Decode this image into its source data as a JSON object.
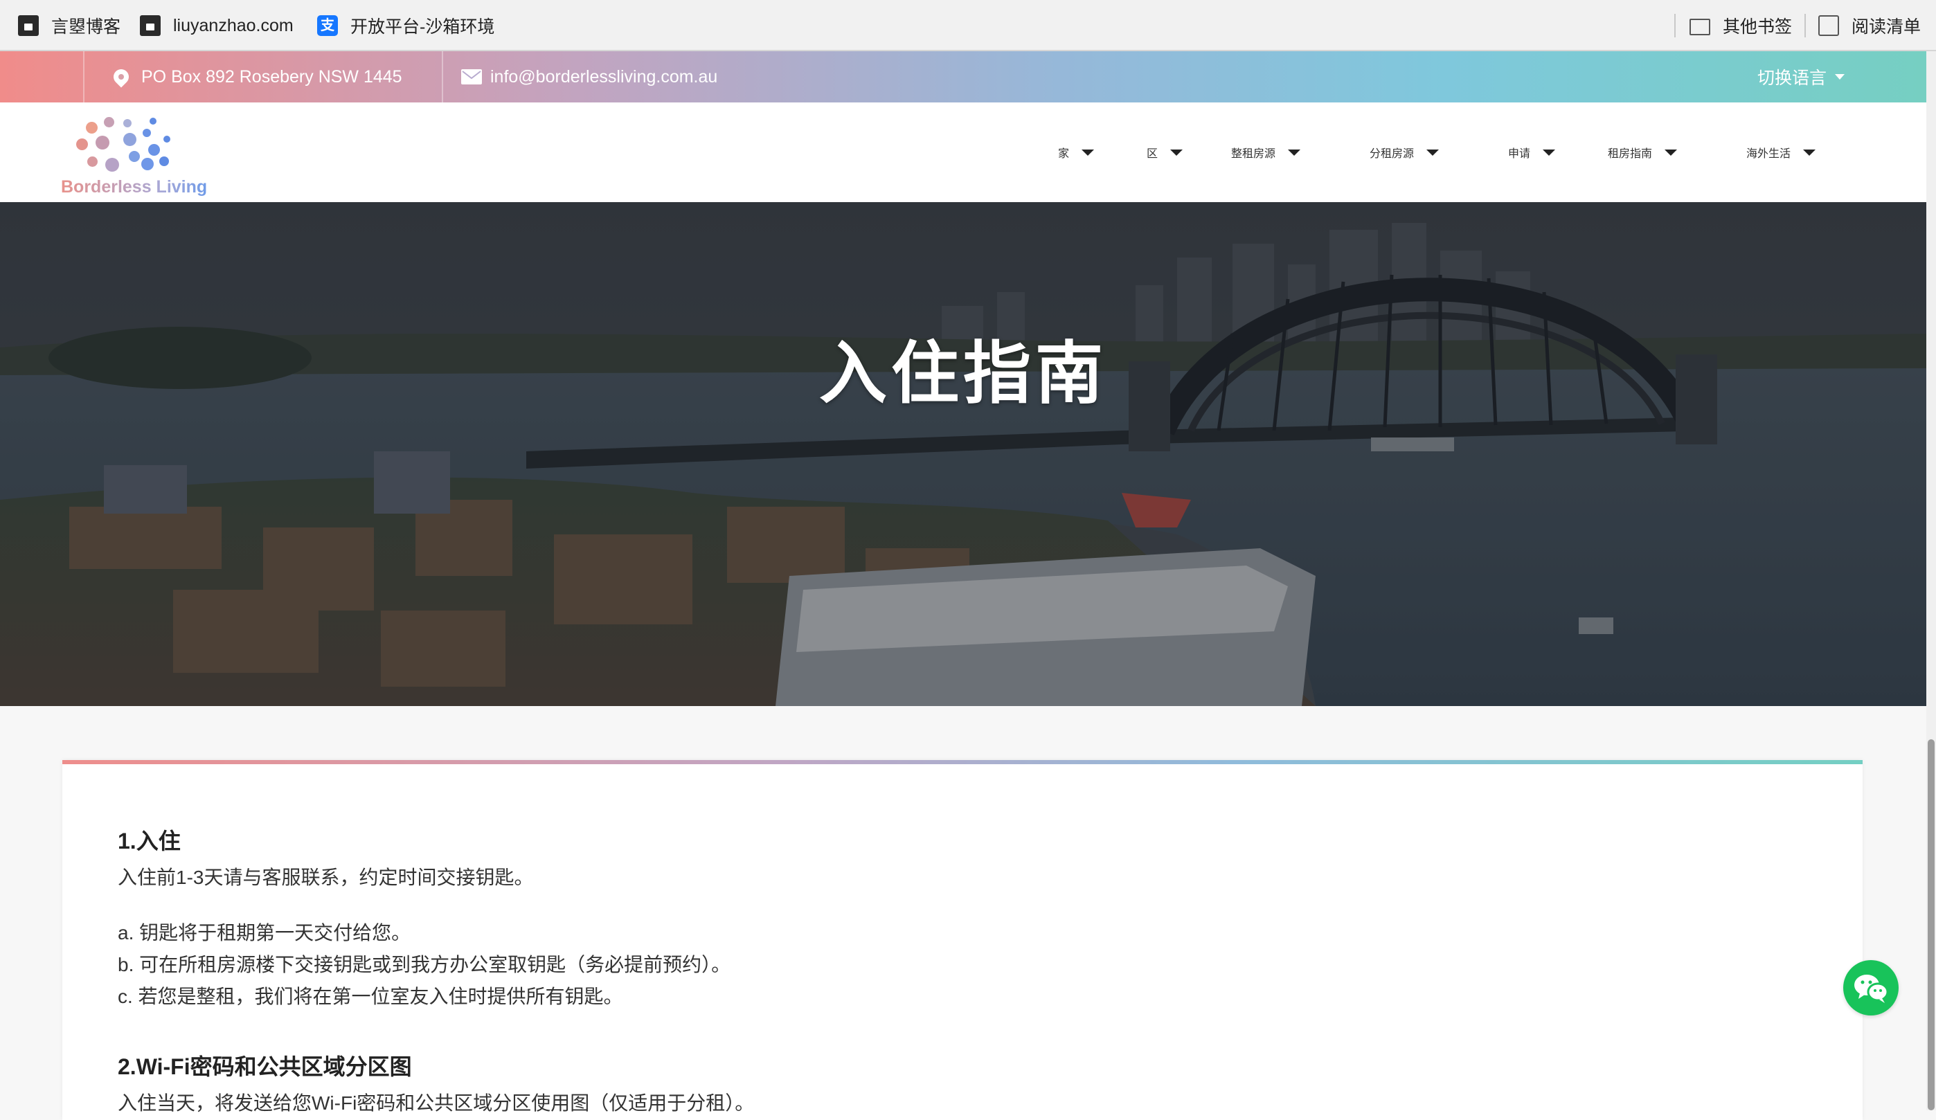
{
  "bookmarks": {
    "items": [
      {
        "label": "言曌博客",
        "icon": "bookmark-site-icon"
      },
      {
        "label": "liuyanzhao.com",
        "icon": "bookmark-site-icon"
      },
      {
        "label": "开放平台-沙箱环境",
        "icon": "alipay-icon"
      }
    ],
    "other_bookmarks": "其他书签",
    "reading_list": "阅读清单"
  },
  "topbar": {
    "address": "PO Box 892 Rosebery NSW 1445",
    "email": "info@borderlessliving.com.au",
    "language_switch": "切换语言"
  },
  "header": {
    "logo_text": "Borderless Living",
    "nav": [
      {
        "label": "家"
      },
      {
        "label": "区"
      },
      {
        "label": "整租房源"
      },
      {
        "label": "分租房源"
      },
      {
        "label": "申请"
      },
      {
        "label": "租房指南"
      },
      {
        "label": "海外生活"
      }
    ]
  },
  "hero": {
    "title": "入住指南"
  },
  "content": {
    "section1": {
      "title": "1.入住",
      "intro": "入住前1-3天请与客服联系，约定时间交接钥匙。",
      "items": [
        "a. 钥匙将于租期第一天交付给您。",
        "b. 可在所租房源楼下交接钥匙或到我方办公室取钥匙（务必提前预约）。",
        "c. 若您是整租，我们将在第一位室友入住时提供所有钥匙。"
      ]
    },
    "section2": {
      "title": "2.Wi-Fi密码和公共区域分区图",
      "intro": "入住当天，将发送给您Wi-Fi密码和公共区域分区使用图（仅适用于分租）。"
    }
  },
  "colors": {
    "gradient_start": "#f08c8a",
    "gradient_end": "#76cfc2",
    "wechat_green": "#18c35a"
  }
}
